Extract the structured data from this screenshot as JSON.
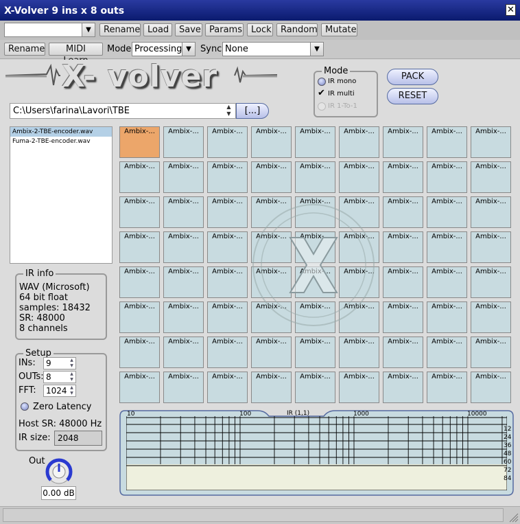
{
  "window": {
    "title": "X-Volver 9 ins x 8 outs",
    "close_label": "✕"
  },
  "toolbar1": {
    "preset_value": "",
    "buttons": [
      "Rename",
      "Load",
      "Save",
      "Params",
      "Lock",
      "Random",
      "Mutate"
    ]
  },
  "toolbar2": {
    "rename_label": "Rename",
    "midi_learn_label": "MIDI Learn",
    "mode_label": "Mode",
    "mode_value": "Processing",
    "sync_label": "Sync",
    "sync_value": "None"
  },
  "logo": {
    "text": "X- volver"
  },
  "mode_group": {
    "title": "Mode",
    "options": [
      {
        "label": "IR mono",
        "type": "radio",
        "enabled": true
      },
      {
        "label": "IR multi",
        "type": "check",
        "checked": true,
        "enabled": true
      },
      {
        "label": "IR 1-To-1",
        "type": "radio",
        "enabled": false
      }
    ]
  },
  "actions": {
    "pack_label": "PACK",
    "reset_label": "RESET"
  },
  "path": {
    "value": "C:\\Users\\farina\\Lavori\\TBE",
    "browse_label": "[...]"
  },
  "files": [
    {
      "name": "Ambix-2-TBE-encoder.wav",
      "selected": true
    },
    {
      "name": "Fuma-2-TBE-encoder.wav",
      "selected": false
    }
  ],
  "ir_info": {
    "title": "IR info",
    "lines": [
      "WAV (Microsoft)",
      "64 bit float",
      "samples: 18432",
      "SR: 48000",
      "8 channels"
    ]
  },
  "setup": {
    "title": "Setup",
    "ins_label": "INs:",
    "ins_value": "9",
    "outs_label": "OUTs:",
    "outs_value": "8",
    "fft_label": "FFT:",
    "fft_value": "1024",
    "zero_latency_label": "Zero Latency",
    "host_sr": "Host SR: 48000 Hz",
    "ir_size_label": "IR size:",
    "ir_size_value": "2048"
  },
  "grid": {
    "rows": 8,
    "cols": 9,
    "cell_label": "Ambix-...",
    "active_cell": [
      0,
      0
    ]
  },
  "graph": {
    "title": "IR (1,1)",
    "x_ticks": [
      "10",
      "100",
      "1000",
      "10000"
    ],
    "y_ticks": [
      "12",
      "24",
      "36",
      "48",
      "60",
      "72",
      "84"
    ]
  },
  "out": {
    "label": "Out",
    "value": "0.00 dB"
  },
  "colors": {
    "active_cell": "#eca66a",
    "cell": "#c8dbe0",
    "accent": "#556aa0"
  }
}
